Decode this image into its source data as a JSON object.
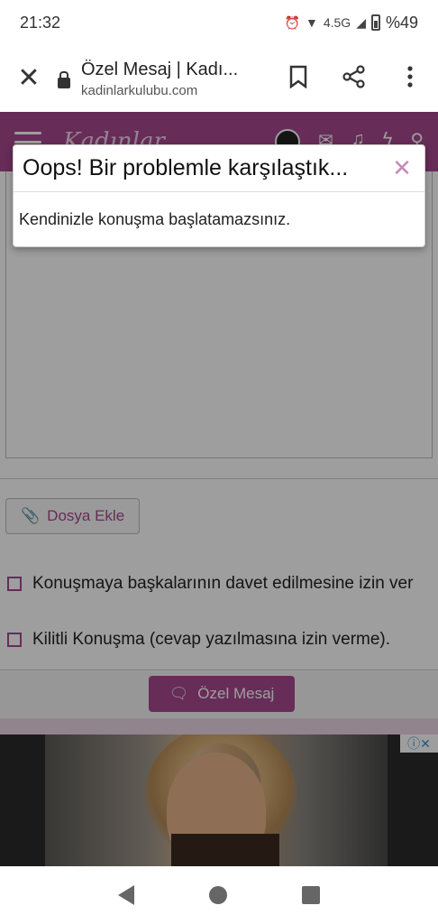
{
  "status": {
    "time": "21:32",
    "network": "4.5G",
    "battery": "%49"
  },
  "browser": {
    "title": "Özel Mesaj | Kadı...",
    "url": "kadinlarkulubu.com"
  },
  "site": {
    "logo": "Kadınlar"
  },
  "form": {
    "attach_label": "Dosya Ekle",
    "option1": "Konuşmaya başkalarının davet edilmesine izin ver",
    "option2": "Kilitli Konuşma (cevap yazılmasına izin verme).",
    "submit_label": "Özel Mesaj"
  },
  "modal": {
    "title": "Oops! Bir problemle karşılaştık...",
    "message": "Kendinizle konuşma başlatamazsınız.",
    "close": "✕"
  },
  "ad": {
    "choices_icon": "ⓘ✕"
  }
}
